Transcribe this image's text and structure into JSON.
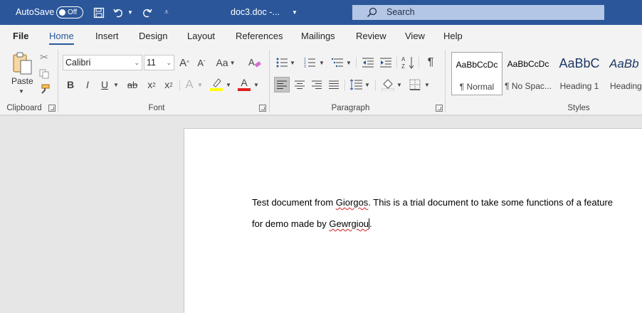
{
  "titlebar": {
    "autosave_label": "AutoSave",
    "autosave_state": "Off",
    "doc_title": "doc3.doc  -...",
    "search_placeholder": "Search"
  },
  "tabs": [
    {
      "label": "File"
    },
    {
      "label": "Home"
    },
    {
      "label": "Insert"
    },
    {
      "label": "Design"
    },
    {
      "label": "Layout"
    },
    {
      "label": "References"
    },
    {
      "label": "Mailings"
    },
    {
      "label": "Review"
    },
    {
      "label": "View"
    },
    {
      "label": "Help"
    }
  ],
  "ribbon": {
    "clipboard": {
      "group_label": "Clipboard",
      "paste_label": "Paste"
    },
    "font": {
      "group_label": "Font",
      "font_name": "Calibri",
      "font_size": "11",
      "change_case": "Aa",
      "bold": "B",
      "italic": "I",
      "underline": "U",
      "strikethrough": "ab",
      "subscript": "x",
      "superscript": "x",
      "sub_mark": "2",
      "sup_mark": "2",
      "effects": "A",
      "color": "A"
    },
    "paragraph": {
      "group_label": "Paragraph"
    },
    "styles": {
      "group_label": "Styles",
      "items": [
        {
          "preview": "AaBbCcDc",
          "name": "¶ Normal"
        },
        {
          "preview": "AaBbCcDc",
          "name": "¶ No Spac..."
        },
        {
          "preview": "AaBbC",
          "name": "Heading 1"
        },
        {
          "preview": "AaBb",
          "name": "Heading"
        }
      ]
    }
  },
  "document": {
    "line1": {
      "a": "Test document from ",
      "b": "Giorgos",
      "c": ". This is a trial document to take some functions of a feature"
    },
    "line2": {
      "a": "for demo made by ",
      "b": "Gewrgiou",
      "c": "."
    }
  },
  "colors": {
    "brand": "#2b579a",
    "highlight": "#ffff00",
    "font_color": "#e02020",
    "spelling": "#d21f1f"
  }
}
